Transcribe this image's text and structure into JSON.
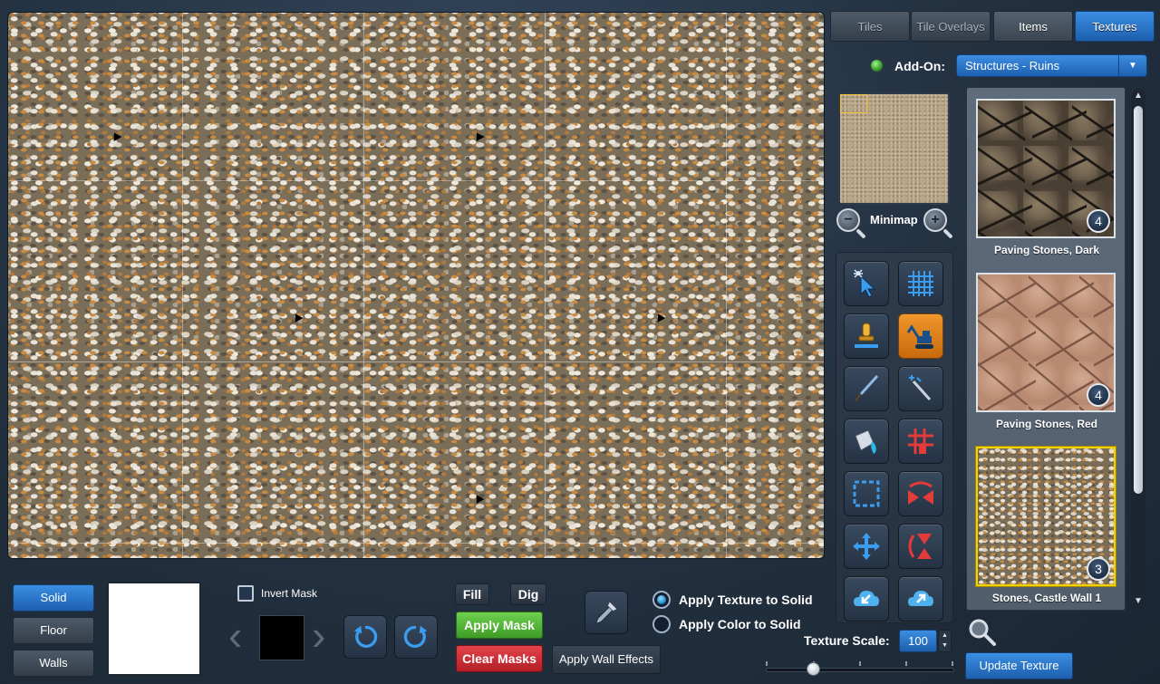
{
  "tabs": [
    {
      "label": "Tiles",
      "state": "disabled"
    },
    {
      "label": "Tile Overlays",
      "state": "disabled"
    },
    {
      "label": "Items",
      "state": "enabled"
    },
    {
      "label": "Textures",
      "state": "active"
    }
  ],
  "addon": {
    "label": "Add-On:",
    "selected": "Structures - Ruins",
    "arrow": "▼"
  },
  "minimap": {
    "label": "Minimap",
    "zoom_out": "−",
    "zoom_in": "+"
  },
  "tools": [
    {
      "name": "select-tool-icon"
    },
    {
      "name": "grid-tool-icon"
    },
    {
      "name": "stamp-tool-icon"
    },
    {
      "name": "excavator-tool-icon",
      "active": true
    },
    {
      "name": "brush-tool-icon"
    },
    {
      "name": "magic-wand-tool-icon"
    },
    {
      "name": "paint-bucket-tool-icon"
    },
    {
      "name": "wall-grid-tool-icon"
    },
    {
      "name": "marquee-select-tool-icon"
    },
    {
      "name": "flip-horizontal-tool-icon"
    },
    {
      "name": "move-tool-icon"
    },
    {
      "name": "flip-vertical-tool-icon"
    },
    {
      "name": "import-tool-icon"
    },
    {
      "name": "export-tool-icon"
    }
  ],
  "textures": [
    {
      "label": "Paving Stones, Dark",
      "count": "4",
      "selected": false
    },
    {
      "label": "Paving Stones, Red",
      "count": "4",
      "selected": false
    },
    {
      "label": "Stones, Castle Wall 1",
      "count": "3",
      "selected": true
    }
  ],
  "layers": {
    "solid": "Solid",
    "floor": "Floor",
    "walls": "Walls",
    "active": "solid"
  },
  "mask": {
    "invert_label": "Invert Mask",
    "fill": "Fill",
    "dig": "Dig",
    "apply": "Apply Mask",
    "clear": "Clear Masks",
    "prev_arrow": "‹",
    "next_arrow": "›"
  },
  "wall_effects": "Apply Wall Effects",
  "apply_options": {
    "texture": "Apply Texture to Solid",
    "color": "Apply Color to Solid",
    "selected": "texture"
  },
  "texture_scale": {
    "label": "Texture Scale:",
    "value": "100",
    "up": "▲",
    "down": "▼",
    "slider_fraction": 0.25
  },
  "update_button": "Update Texture",
  "scroll": {
    "up": "▲",
    "down": "▼"
  },
  "colors": {
    "accent": "#2b74cc",
    "active_tool": "#e58421",
    "apply_green": "#55b83a",
    "clear_red": "#cf2f36",
    "selection_yellow": "#f2d300"
  }
}
